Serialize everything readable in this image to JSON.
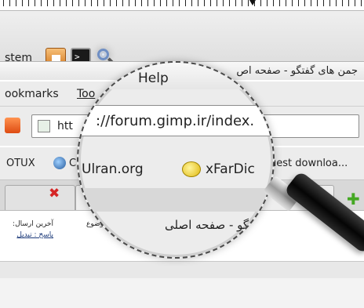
{
  "panel": {
    "text": "stem"
  },
  "launchers": {
    "home": "home-icon",
    "terminal": "terminal-icon",
    "terminal_glyph": ">_",
    "search": "magnifier-icon"
  },
  "window": {
    "title": "جمن های گفتگو - صفحه اص"
  },
  "menu": {
    "bookmarks": "ookmarks",
    "tools": "Too",
    "help": "Help"
  },
  "nav": {
    "url_small": "htt",
    "url_magnified": "://forum.gimp.ir/index."
  },
  "bookmarks": {
    "item1": "OTUX",
    "item2": "C",
    "item3": "Ulran.org",
    "item4": "xFarDic",
    "item5": "uest downloa..."
  },
  "tabs": {
    "close_symbol": "✖",
    "new_symbol": "✚",
    "active_title": "گفتگو - صفحه اصلی"
  },
  "content": {
    "last_post": "آخرین ارسال:",
    "reply": "پاسخ : تبدیل",
    "subject": "موضوع"
  },
  "colors": {
    "close": "#d52626",
    "new_tab": "#44a823",
    "link": "#1d3b7a"
  }
}
